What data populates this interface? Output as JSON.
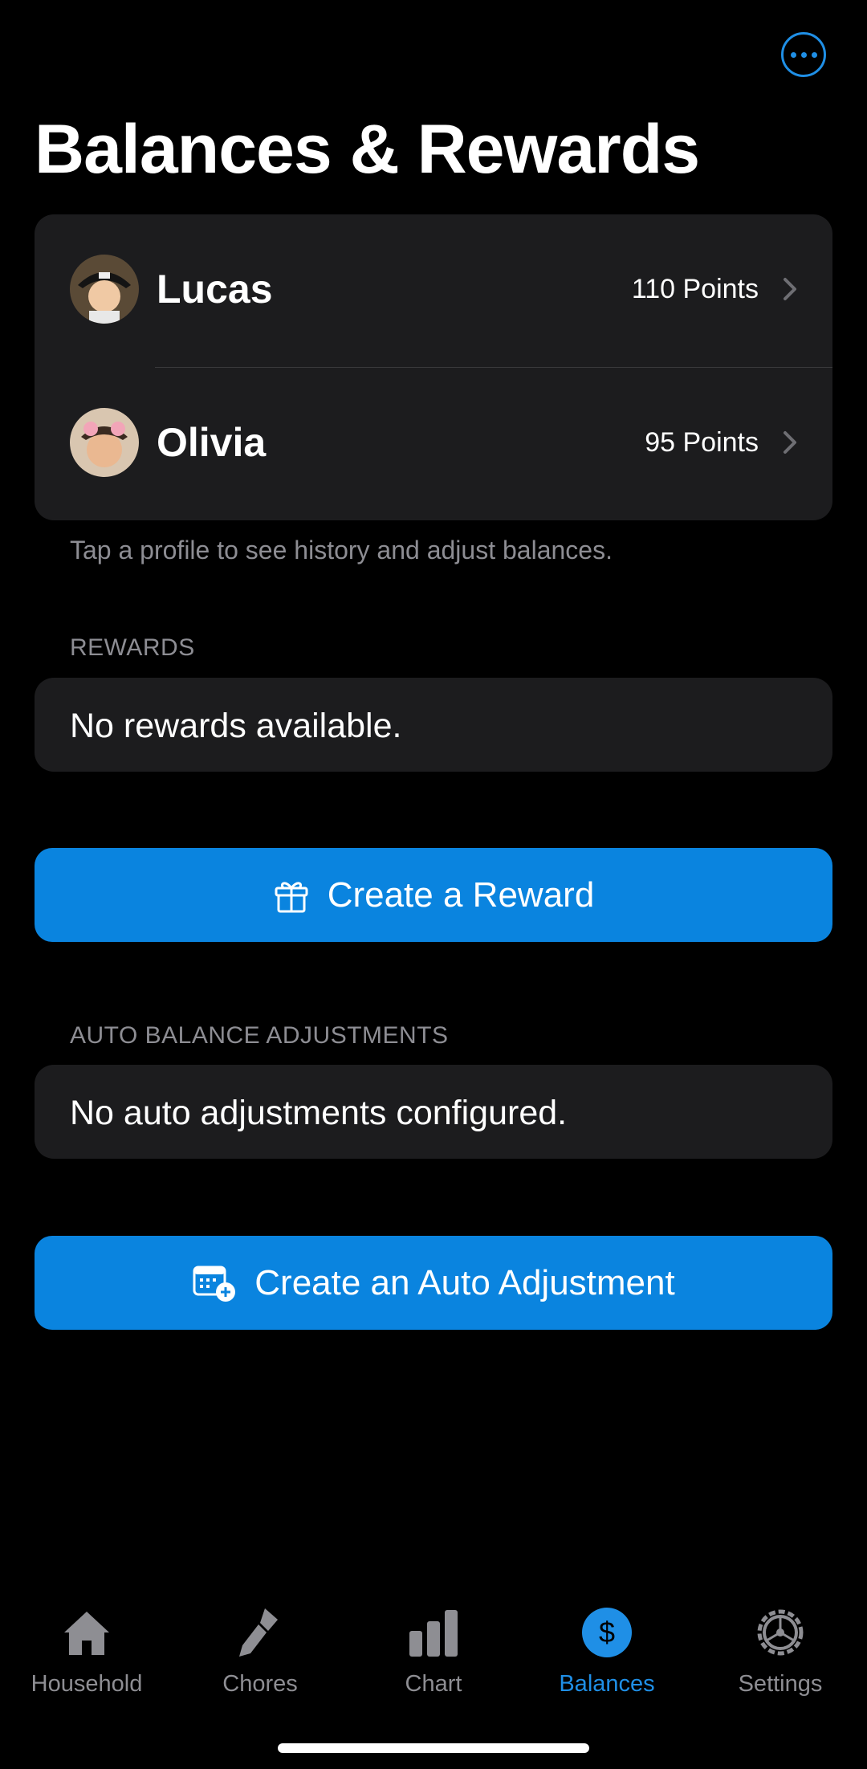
{
  "header": {
    "title": "Balances & Rewards",
    "more_icon": "ellipsis-circle-icon"
  },
  "profiles": {
    "items": [
      {
        "name": "Lucas",
        "points": "110 Points"
      },
      {
        "name": "Olivia",
        "points": "95 Points"
      }
    ],
    "hint": "Tap a profile to see history and adjust balances."
  },
  "rewards": {
    "section_label": "REWARDS",
    "empty_text": "No rewards available.",
    "create_button": "Create a Reward",
    "create_icon": "gift-icon"
  },
  "auto_adjust": {
    "section_label": "AUTO BALANCE ADJUSTMENTS",
    "empty_text": "No auto adjustments configured.",
    "create_button": "Create an Auto Adjustment",
    "create_icon": "calendar-plus-icon"
  },
  "tabbar": {
    "tabs": [
      {
        "label": "Household",
        "icon": "house-icon"
      },
      {
        "label": "Chores",
        "icon": "brush-icon"
      },
      {
        "label": "Chart",
        "icon": "bar-chart-icon"
      },
      {
        "label": "Balances",
        "icon": "dollar-circle-icon"
      },
      {
        "label": "Settings",
        "icon": "gear-icon"
      }
    ],
    "active": "Balances"
  },
  "colors": {
    "accent": "#0a84df",
    "card": "#1c1c1e",
    "secondary_text": "#8d8d93"
  }
}
